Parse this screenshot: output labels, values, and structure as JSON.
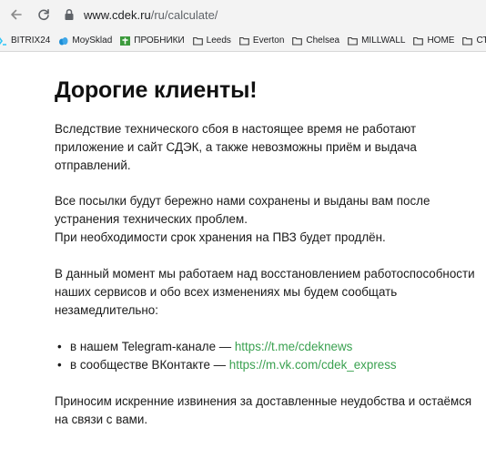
{
  "browser": {
    "url_host": "www.cdek.ru",
    "url_path": "/ru/calculate/"
  },
  "bookmarks": [
    {
      "label": "BITRIX24",
      "icon": "bitrix-icon"
    },
    {
      "label": "MoySklad",
      "icon": "moysklad-icon"
    },
    {
      "label": "ПРОБНИКИ",
      "icon": "green-cross-icon"
    },
    {
      "label": "Leeds",
      "icon": "folder-icon"
    },
    {
      "label": "Everton",
      "icon": "folder-icon"
    },
    {
      "label": "Chelsea",
      "icon": "folder-icon"
    },
    {
      "label": "MILLWALL",
      "icon": "folder-icon"
    },
    {
      "label": "HOME",
      "icon": "folder-icon"
    },
    {
      "label": "СТРИМ",
      "icon": "folder-icon"
    }
  ],
  "page": {
    "title": "Дорогие клиенты!",
    "p1": [
      "Вследствие технического сбоя в настоящее время не работают",
      "приложение и сайт СДЭК, а также невозможны приём и выдача",
      "отправлений."
    ],
    "p2": [
      "Все посылки будут бережно нами сохранены и выданы вам после",
      "устранения технических проблем.",
      "При необходимости срок хранения на ПВЗ будет продлён."
    ],
    "p3": [
      "В данный момент мы работаем над восстановлением работоспособности",
      "наших сервисов и обо всех изменениях мы будем сообщать",
      "незамедлительно:"
    ],
    "links": [
      {
        "prefix": "в нашем Telegram-канале — ",
        "link": "https://t.me/cdeknews"
      },
      {
        "prefix": "в сообществе ВКонтакте — ",
        "link": "https://m.vk.com/cdek_express"
      }
    ],
    "p4": [
      "Приносим искренние извинения за доставленные неудобства и остаёмся",
      "на связи с вами."
    ],
    "link_color": "#3aa150"
  }
}
